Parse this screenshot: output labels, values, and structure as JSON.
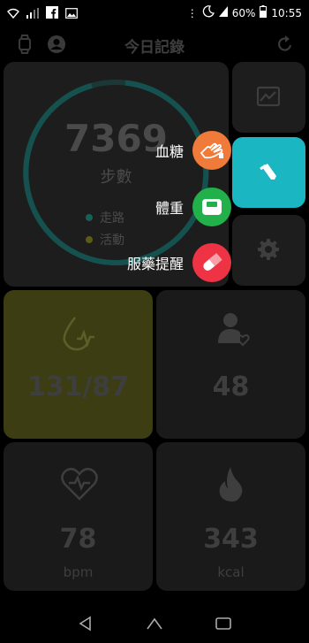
{
  "status": {
    "battery": "60%",
    "time": "10:55"
  },
  "header": {
    "title": "今日記錄"
  },
  "steps": {
    "count": "7369",
    "label": "步數",
    "legend": [
      {
        "label": "走路",
        "color": "#1a8a82"
      },
      {
        "label": "活動",
        "color": "#8b8a16"
      }
    ]
  },
  "blood_pressure": {
    "value": "131/87"
  },
  "heart_rate": {
    "value": "48"
  },
  "bpm": {
    "value": "78",
    "unit": "bpm"
  },
  "calories": {
    "value": "343",
    "unit": "kcal"
  },
  "fab_menu": [
    {
      "label": "血糖",
      "color": "#f07a3a",
      "icon": "blood-glucose-icon"
    },
    {
      "label": "體重",
      "color": "#22b04a",
      "icon": "weight-scale-icon"
    },
    {
      "label": "服藥提醒",
      "color": "#ee3344",
      "icon": "pill-icon"
    }
  ],
  "colors": {
    "accent": "#1ab6c1",
    "bp_card": "#3d3d14"
  }
}
